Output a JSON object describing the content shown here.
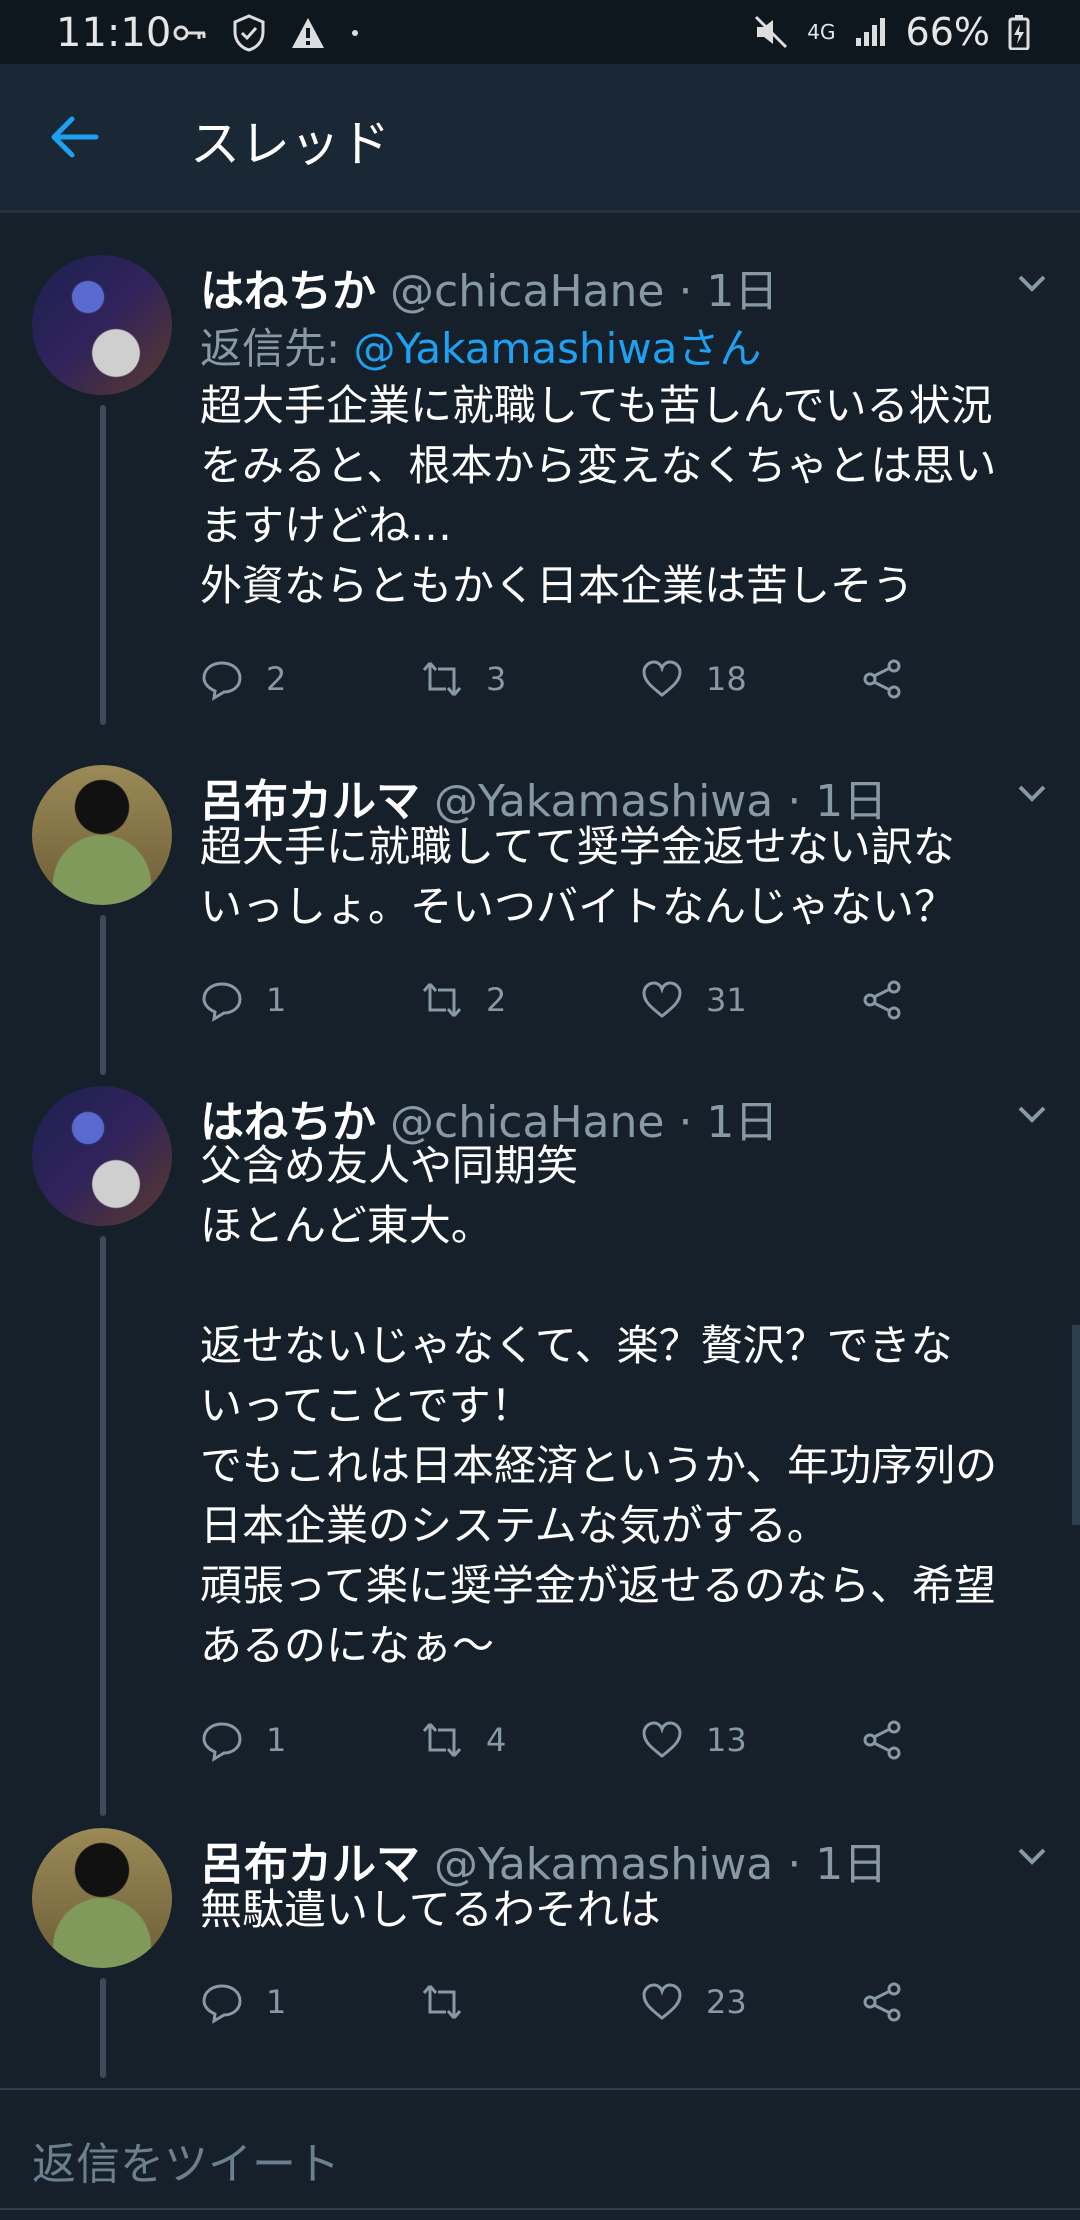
{
  "status_bar": {
    "time": "11:10",
    "network": "4G",
    "battery": "66%",
    "icons": [
      "key-icon",
      "shield-icon",
      "warning-icon",
      "dot-icon",
      "mute-icon",
      "signal-icon",
      "battery-icon"
    ]
  },
  "header": {
    "title": "スレッド",
    "back_icon": "back-arrow-icon"
  },
  "tweets": [
    {
      "name": "はねちか",
      "handle": "@chicaHane · 1日",
      "reply_prefix": "返信先: ",
      "reply_mention": "@Yakamashiwaさん",
      "text": "超大手企業に就職しても苦しんでいる状況\nをみると、根本から変えなくちゃとは思い\nますけどね…\n外資ならともかく日本企業は苦しそう",
      "replies": "2",
      "retweets": "3",
      "likes": "18"
    },
    {
      "name": "呂布カルマ",
      "handle": "@Yakamashiwa · 1日",
      "text": "超大手に就職してて奨学金返せない訳な\nいっしょ。そいつバイトなんじゃない？",
      "replies": "1",
      "retweets": "2",
      "likes": "31"
    },
    {
      "name": "はねちか",
      "handle": "@chicaHane · 1日",
      "text": "父含め友人や同期笑\nほとんど東大。\n\n返せないじゃなくて、楽？贅沢？できな\nいってことです！\nでもこれは日本経済というか、年功序列の\n日本企業のシステムな気がする。\n頑張って楽に奨学金が返せるのなら、希望\nあるのになぁ〜",
      "replies": "1",
      "retweets": "4",
      "likes": "13"
    },
    {
      "name": "呂布カルマ",
      "handle": "@Yakamashiwa · 1日",
      "text": "無駄遣いしてるわそれは",
      "replies": "1",
      "retweets": "",
      "likes": "23"
    }
  ],
  "compose": {
    "placeholder": "返信をツイート"
  },
  "colors": {
    "background": "#15202b",
    "accent": "#1da1f2",
    "muted": "#8899a6"
  }
}
